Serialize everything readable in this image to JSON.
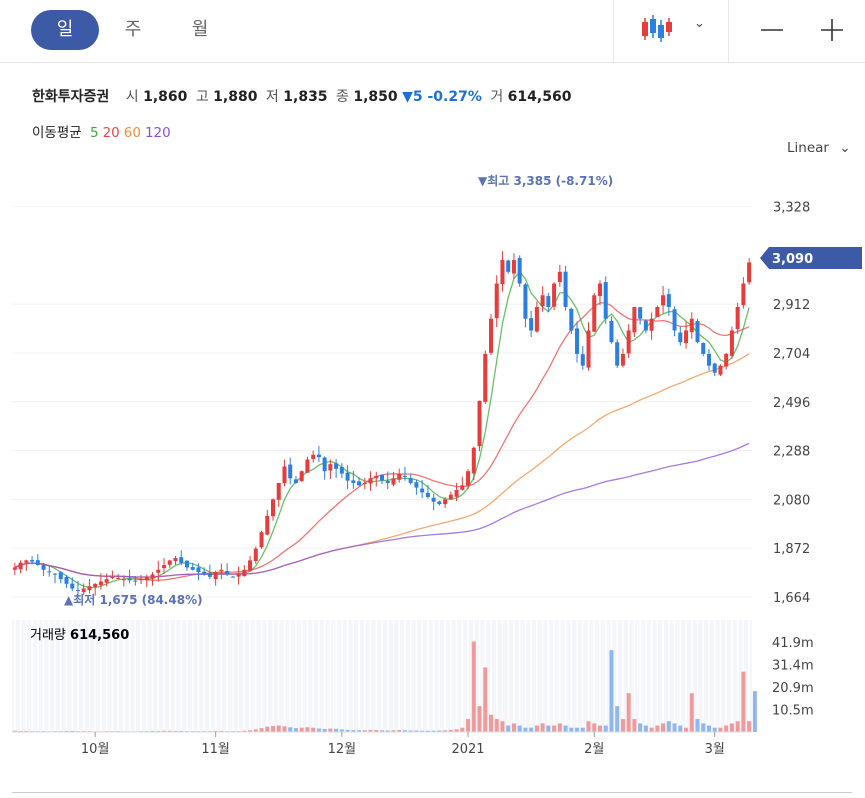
{
  "period_tabs": [
    "일",
    "주",
    "월"
  ],
  "active_period": "일",
  "chart_type_icon": "candlestick-icon",
  "stock": {
    "name": "한화투자증권",
    "open_label": "시",
    "open": "1,860",
    "high_label": "고",
    "high": "1,880",
    "low_label": "저",
    "low": "1,835",
    "close_label": "종",
    "close": "1,850",
    "change": "▼5 -0.27%",
    "volume_label": "거",
    "volume": "614,560"
  },
  "moving_average": {
    "label": "이동평균",
    "periods": [
      {
        "period": "5",
        "color": "#3aaa35"
      },
      {
        "period": "20",
        "color": "#e84848"
      },
      {
        "period": "60",
        "color": "#f08c3c"
      },
      {
        "period": "120",
        "color": "#8a4fd8"
      }
    ]
  },
  "scale_label": "Linear",
  "colors": {
    "up": "#e63c3c",
    "down": "#2b7fe0",
    "accent": "#3d5aa6"
  },
  "chart_data": {
    "type": "candlestick",
    "x_labels": [
      "10월",
      "11월",
      "12월",
      "2021",
      "2월",
      "3월"
    ],
    "price_ticks": [
      "3,328",
      "2,912",
      "2,704",
      "2,496",
      "2,288",
      "2,080",
      "1,872",
      "1,664"
    ],
    "price_ylim": [
      1600,
      3420
    ],
    "current_price": "3,090",
    "max_annotation": "▼최고 3,385 (-8.71%)",
    "min_annotation": "▲최저 1,675 (84.48%)",
    "volume_title": "거래량",
    "volume_value": "614,560",
    "volume_ticks": [
      "41.9m",
      "31.4m",
      "20.9m",
      "10.5m"
    ],
    "volume_ylim": [
      0,
      52
    ],
    "price_series": [
      1790,
      1810,
      1820,
      1815,
      1800,
      1780,
      1770,
      1760,
      1740,
      1720,
      1700,
      1690,
      1700,
      1710,
      1720,
      1730,
      1740,
      1750,
      1745,
      1740,
      1735,
      1730,
      1740,
      1750,
      1760,
      1780,
      1800,
      1820,
      1830,
      1810,
      1790,
      1780,
      1770,
      1760,
      1750,
      1770,
      1780,
      1760,
      1750,
      1760,
      1780,
      1820,
      1870,
      1940,
      2010,
      2080,
      2150,
      2220,
      2170,
      2150,
      2200,
      2250,
      2270,
      2260,
      2200,
      2230,
      2210,
      2190,
      2160,
      2150,
      2140,
      2150,
      2170,
      2180,
      2160,
      2150,
      2170,
      2190,
      2180,
      2150,
      2130,
      2110,
      2090,
      2070,
      2060,
      2080,
      2100,
      2120,
      2140,
      2200,
      2300,
      2500,
      2700,
      2850,
      3000,
      3100,
      3050,
      3100,
      3000,
      2850,
      2800,
      2900,
      2950,
      2900,
      3000,
      3050,
      2900,
      2800,
      2700,
      2650,
      2800,
      2950,
      3000,
      2850,
      2750,
      2650,
      2700,
      2800,
      2900,
      2850,
      2800,
      2850,
      2900,
      2950,
      2900,
      2800,
      2750,
      2800,
      2850,
      2750,
      2700,
      2650,
      2620,
      2650,
      2700,
      2800,
      2900,
      3000,
      3090
    ],
    "volume_series": [
      0.6,
      0.5,
      0.5,
      0.4,
      0.4,
      0.4,
      0.3,
      0.4,
      0.4,
      0.5,
      0.5,
      0.4,
      0.4,
      0.4,
      0.3,
      0.3,
      0.4,
      0.4,
      0.4,
      0.3,
      0.3,
      0.3,
      0.4,
      0.4,
      0.5,
      0.5,
      0.6,
      0.6,
      0.5,
      0.5,
      0.4,
      0.4,
      0.4,
      0.4,
      0.4,
      0.5,
      0.5,
      0.4,
      0.4,
      0.4,
      0.6,
      0.8,
      1.2,
      1.8,
      2.5,
      2.8,
      3.0,
      2.6,
      2.2,
      1.8,
      2.0,
      2.2,
      2.0,
      1.6,
      1.4,
      1.6,
      1.5,
      1.2,
      1.0,
      0.9,
      0.8,
      0.8,
      0.9,
      0.9,
      0.8,
      0.7,
      0.8,
      0.9,
      0.8,
      0.7,
      0.7,
      0.6,
      0.6,
      0.6,
      0.7,
      0.8,
      0.9,
      1.2,
      2.0,
      6.0,
      42.0,
      12.0,
      30.0,
      8.0,
      6.0,
      5.0,
      3.0,
      4.0,
      3.0,
      2.0,
      2.0,
      3.0,
      4.0,
      3.0,
      3.0,
      4.0,
      3.0,
      2.0,
      2.0,
      2.0,
      5.0,
      4.0,
      3.0,
      3.0,
      38.0,
      12.0,
      6.0,
      18.0,
      6.0,
      4.0,
      3.0,
      2.0,
      3.0,
      4.0,
      5.0,
      4.0,
      3.0,
      2.0,
      18.0,
      6.0,
      4.0,
      3.0,
      2.0,
      2.0,
      3.0,
      4.0,
      5.0,
      28.0,
      5.0,
      19.0
    ]
  }
}
